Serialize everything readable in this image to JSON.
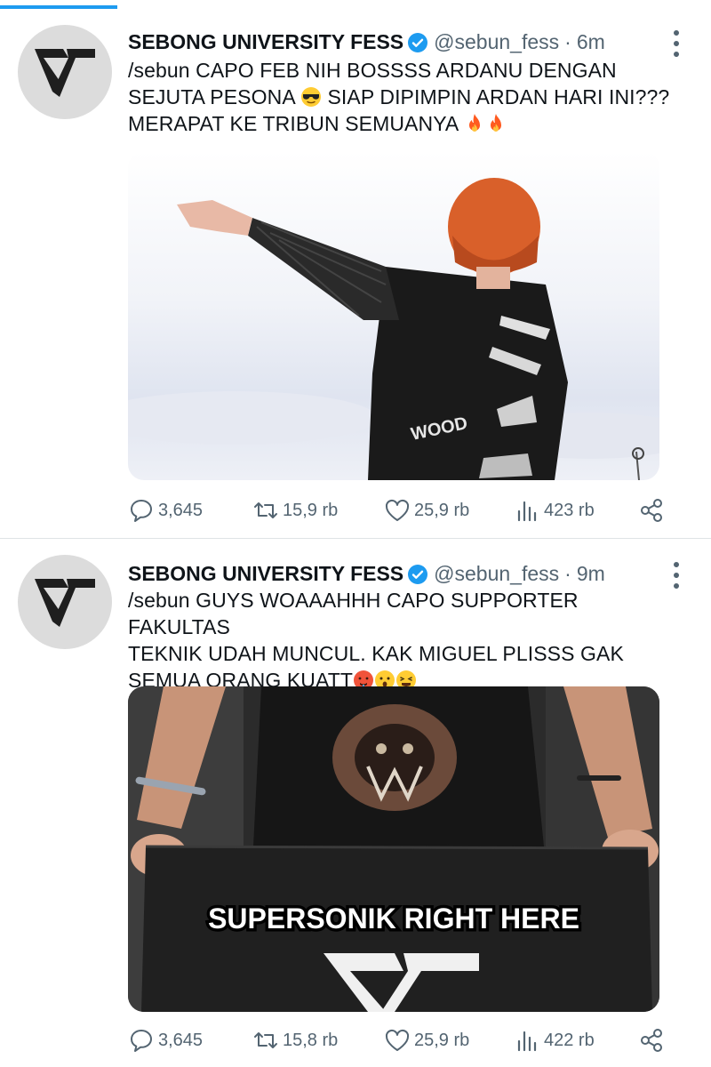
{
  "colors": {
    "accent": "#1d9bf0",
    "muted": "#536471",
    "text": "#0f1419",
    "divider": "#dfe3e6"
  },
  "tweets": [
    {
      "display_name": "SEBONG UNIVERSITY FESS",
      "verified": true,
      "handle": "@sebun_fess",
      "separator": "·",
      "time": "6m",
      "text_line1": "/sebun CAPO FEB NIH BOSSSS ARDANU  DENGAN",
      "text_line2a": "SEJUTA PESONA ",
      "text_line2b": " SIAP DIPIMPIN ARDAN HARI INI???",
      "text_line3": "MERAPAT KE TRIBUN SEMUANYA ",
      "emojis": [
        "sunglasses-emoji",
        "fire-emoji",
        "fire-emoji"
      ],
      "image": "person-with-red-hair-pointing-photo",
      "replies": "3,645",
      "retweets": "15,9 rb",
      "likes": "25,9 rb",
      "views": "423 rb"
    },
    {
      "display_name": "SEBONG UNIVERSITY FESS",
      "verified": true,
      "handle": "@sebun_fess",
      "separator": "·",
      "time": "9m",
      "text_line1": "/sebun GUYS WOAAAHHH CAPO SUPPORTER FAKULTAS",
      "text_line2": "TEKNIK UDAH MUNCUL. KAK MIGUEL PLISSS GAK",
      "text_line3": "SEMUA ORANG KUATT",
      "emojis": [
        "hot-face-emoji",
        "surprised-face-emoji",
        "tired-face-emoji"
      ],
      "image": "person-holding-flag-photo",
      "image_caption": "SUPERSONIK RIGHT HERE",
      "replies": "3,645",
      "retweets": "15,8 rb",
      "likes": "25,9 rb",
      "views": "422 rb"
    }
  ]
}
